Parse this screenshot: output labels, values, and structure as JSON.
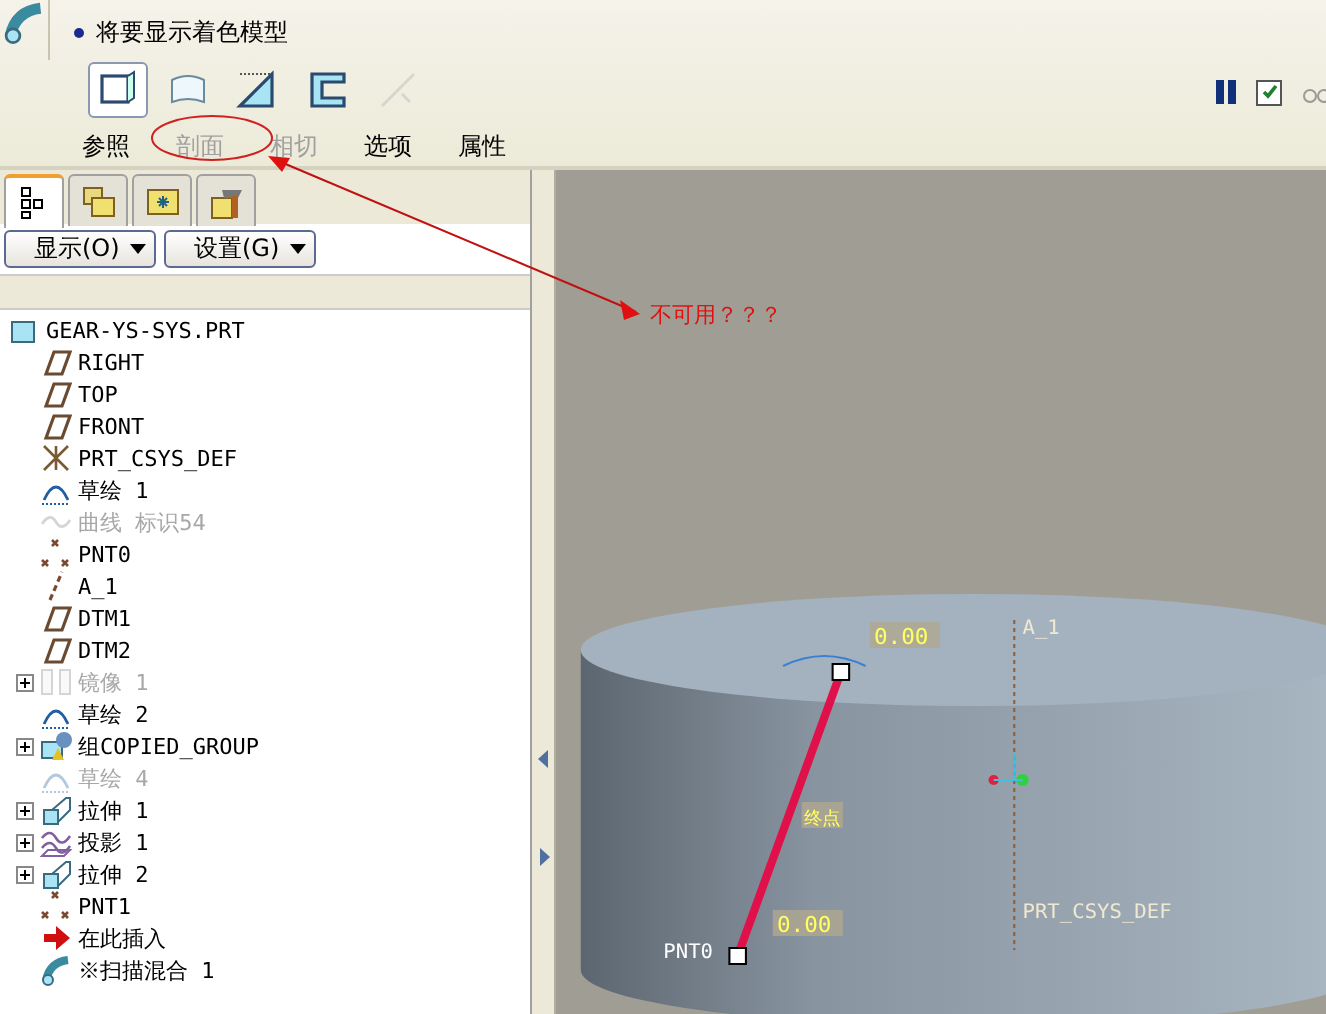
{
  "prompt": "将要显示着色模型",
  "tools": [
    {
      "kind": "solid",
      "selected": true,
      "disabled": false
    },
    {
      "kind": "surface",
      "selected": false,
      "disabled": false
    },
    {
      "kind": "remove",
      "selected": false,
      "disabled": false
    },
    {
      "kind": "thicken",
      "selected": false,
      "disabled": false
    },
    {
      "kind": "tangent",
      "selected": false,
      "disabled": true
    }
  ],
  "tabs": [
    {
      "label": "参照",
      "disabled": false
    },
    {
      "label": "剖面",
      "disabled": true
    },
    {
      "label": "相切",
      "disabled": true
    },
    {
      "label": "选项",
      "disabled": false
    },
    {
      "label": "属性",
      "disabled": false
    }
  ],
  "right_controls": {
    "paused": true,
    "preview_checked": true
  },
  "panel_tabs": [
    {
      "kind": "tree",
      "selected": true
    },
    {
      "kind": "folders",
      "selected": false
    },
    {
      "kind": "favorites",
      "selected": false
    },
    {
      "kind": "tools",
      "selected": false
    }
  ],
  "panel_buttons": [
    "显示(O)",
    "设置(G)"
  ],
  "tree": {
    "label": "GEAR-YS-SYS.PRT",
    "kind": "part",
    "children": [
      {
        "label": "RIGHT",
        "kind": "plane",
        "disabled": false,
        "collapsed": false
      },
      {
        "label": "TOP",
        "kind": "plane",
        "disabled": false,
        "collapsed": false
      },
      {
        "label": "FRONT",
        "kind": "plane",
        "disabled": false,
        "collapsed": false
      },
      {
        "label": "PRT_CSYS_DEF",
        "kind": "csys",
        "disabled": false,
        "collapsed": false
      },
      {
        "label": "草绘 1",
        "kind": "sketch",
        "disabled": false,
        "collapsed": false
      },
      {
        "label": "曲线 标识54",
        "kind": "curve",
        "disabled": true,
        "collapsed": false
      },
      {
        "label": "PNT0",
        "kind": "point",
        "disabled": false,
        "collapsed": false
      },
      {
        "label": "A_1",
        "kind": "axis",
        "disabled": false,
        "collapsed": false
      },
      {
        "label": "DTM1",
        "kind": "plane",
        "disabled": false,
        "collapsed": false
      },
      {
        "label": "DTM2",
        "kind": "plane",
        "disabled": false,
        "collapsed": false
      },
      {
        "label": "镜像 1",
        "kind": "mirror",
        "disabled": true,
        "collapsed": true
      },
      {
        "label": "草绘 2",
        "kind": "sketch",
        "disabled": false,
        "collapsed": false
      },
      {
        "label": "组COPIED_GROUP",
        "kind": "group",
        "disabled": false,
        "collapsed": true
      },
      {
        "label": "草绘 4",
        "kind": "sketch",
        "disabled": true,
        "collapsed": false
      },
      {
        "label": "拉伸 1",
        "kind": "extrude",
        "disabled": false,
        "collapsed": true
      },
      {
        "label": "投影 1",
        "kind": "projection",
        "disabled": false,
        "collapsed": true
      },
      {
        "label": "拉伸 2",
        "kind": "extrude",
        "disabled": false,
        "collapsed": true
      },
      {
        "label": "PNT1",
        "kind": "point",
        "disabled": false,
        "collapsed": false
      },
      {
        "label": "在此插入",
        "kind": "insert",
        "disabled": false,
        "collapsed": false
      },
      {
        "label": "※扫描混合 1",
        "kind": "sweep",
        "disabled": false,
        "collapsed": false
      }
    ]
  },
  "viewport": {
    "top_dimension": "0.00",
    "middle_label": "终点",
    "bottom_dimension": "0.00",
    "point_label": "PNT0",
    "axis_label": "A_1",
    "csys_label": "PRT_CSYS_DEF"
  },
  "annotation": {
    "text": "不可用？？？"
  }
}
